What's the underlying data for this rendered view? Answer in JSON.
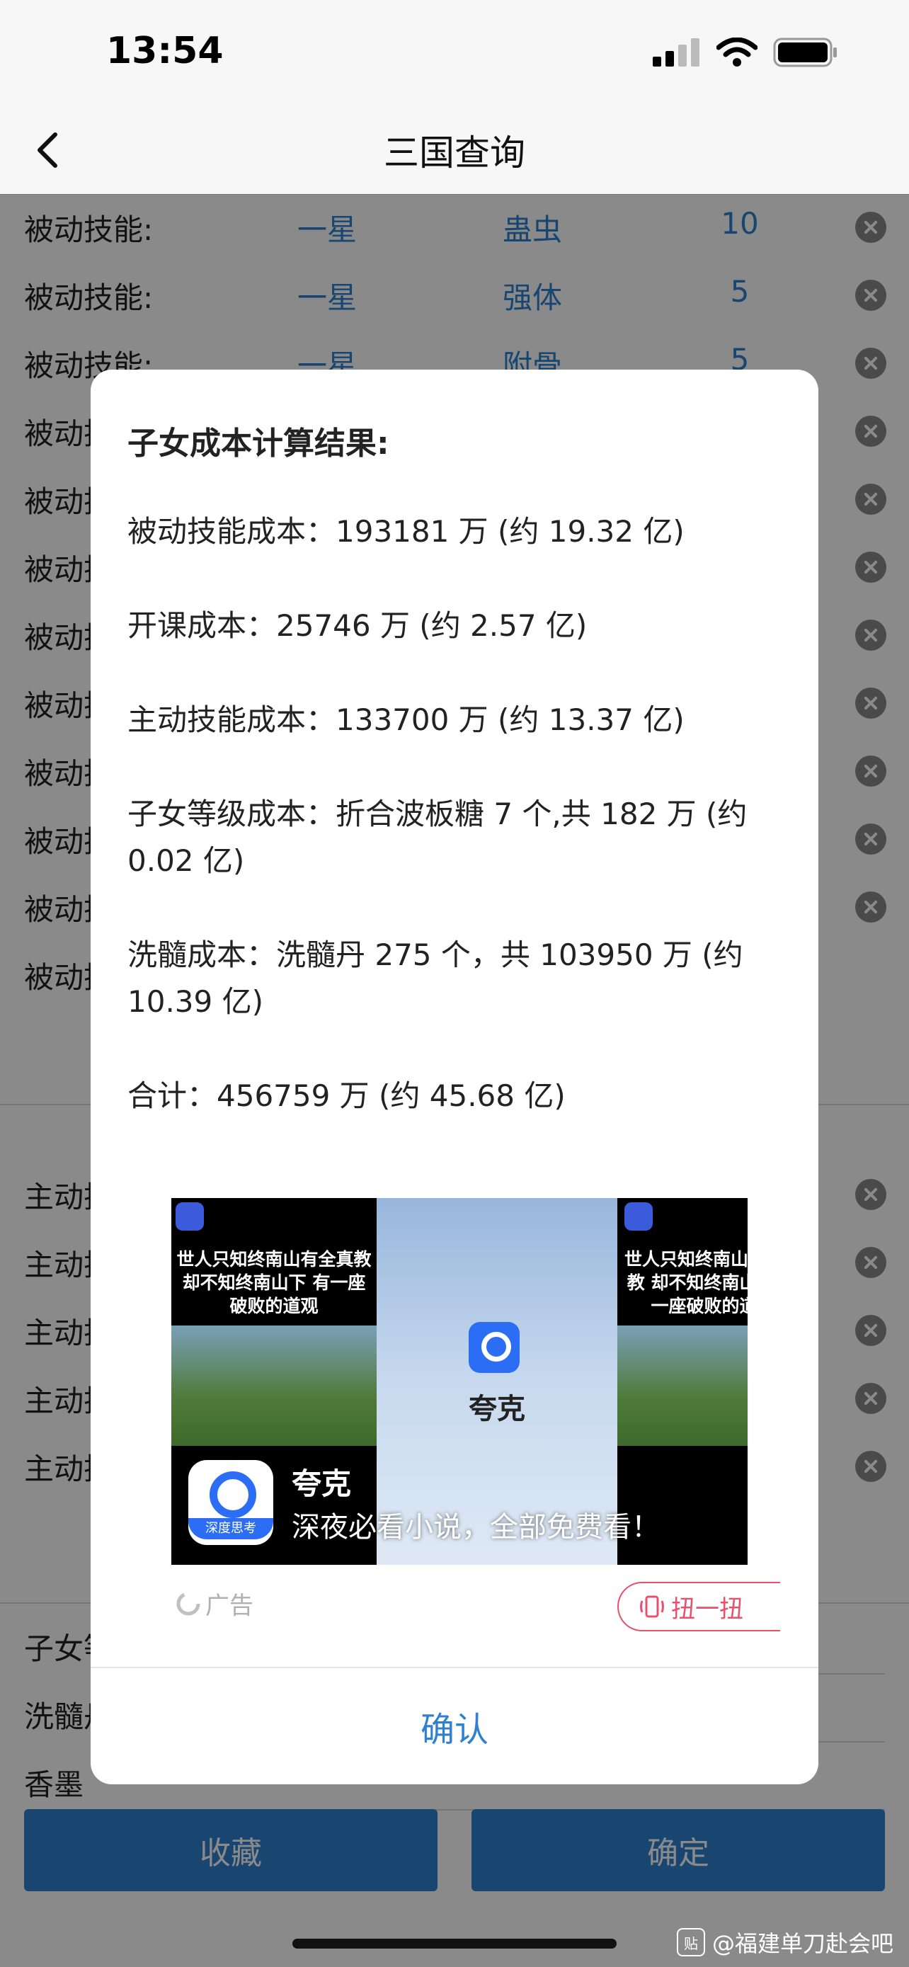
{
  "status": {
    "time": "13:54"
  },
  "nav": {
    "title": "三国查询"
  },
  "passive_rows": [
    {
      "label": "被动技能:",
      "star": "一星",
      "skill": "蛊虫",
      "level": "10"
    },
    {
      "label": "被动技能:",
      "star": "一星",
      "skill": "强体",
      "level": "5"
    },
    {
      "label": "被动技能:",
      "star": "一星",
      "skill": "附骨",
      "level": "5"
    },
    {
      "label": "被动技能:"
    },
    {
      "label": "被动技能:"
    },
    {
      "label": "被动技能:"
    },
    {
      "label": "被动技能:"
    },
    {
      "label": "被动技能:"
    },
    {
      "label": "被动技能:"
    },
    {
      "label": "被动技能:"
    },
    {
      "label": "被动技能:"
    },
    {
      "label": "被动技能:"
    }
  ],
  "active_rows": [
    {
      "label": "主动技能:"
    },
    {
      "label": "主动技能:"
    },
    {
      "label": "主动技能:"
    },
    {
      "label": "主动技能:"
    },
    {
      "label": "主动技能:"
    }
  ],
  "bottom_fields": [
    {
      "label": "子女等级"
    },
    {
      "label": "洗髓丹"
    },
    {
      "label": "香墨"
    }
  ],
  "buttons": {
    "favorite": "收藏",
    "confirm": "确定"
  },
  "dialog": {
    "title": "子女成本计算结果:",
    "lines": [
      "被动技能成本：193181 万 (约 19.32 亿)",
      "开课成本：25746 万 (约 2.57 亿)",
      "主动技能成本：133700 万 (约 13.37 亿)",
      "子女等级成本：折合波板糖 7 个,共 182 万 (约 0.02 亿)",
      "洗髓成本：洗髓丹 275 个，共 103950 万 (约 10.39 亿)",
      "合计：456759 万 (约 45.68 亿)"
    ],
    "confirm_label": "确认"
  },
  "ad": {
    "caption": "世人只知终南山有全真教 却不知终南山下 有一座破败的道观",
    "brand": "夸克",
    "app_name": "夸克",
    "app_icon_label": "深度思考",
    "slogan": "深夜必看小说，全部免费看！",
    "label": "广告",
    "cta": "扭一扭"
  },
  "watermark": "@福建单刀赴会吧"
}
